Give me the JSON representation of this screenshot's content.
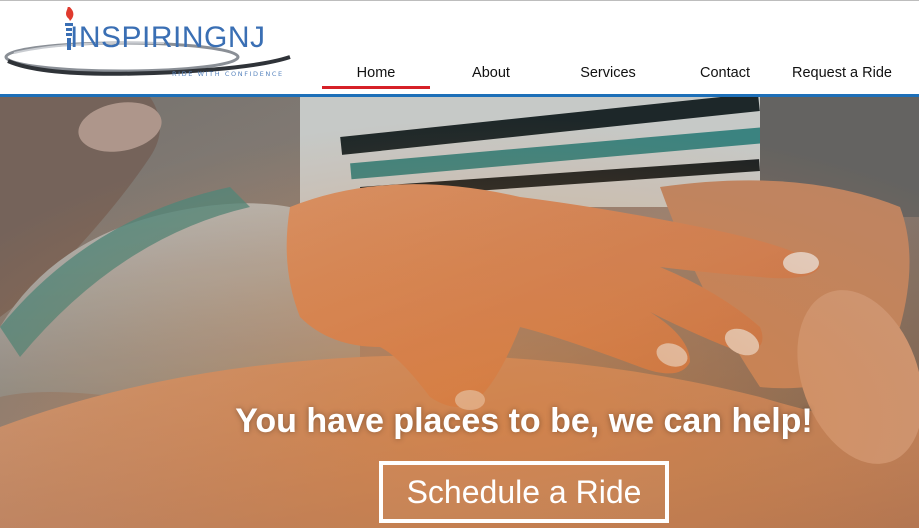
{
  "brand": {
    "name": "INSPIRINGNJ",
    "tagline": "RIDE WITH CONFIDENCE",
    "primary_color": "#3a6fb4",
    "accent_color": "#d62027",
    "logo_icon": "torch-icon"
  },
  "nav": {
    "items": [
      {
        "label": "Home",
        "active": true
      },
      {
        "label": "About",
        "active": false
      },
      {
        "label": "Services",
        "active": false
      },
      {
        "label": "Contact",
        "active": false
      },
      {
        "label": "Request a Ride",
        "active": false
      }
    ],
    "active_indicator_color": "#d62027",
    "rule_color": "#1d6fb8"
  },
  "hero": {
    "image": "hands-holding-photo",
    "headline": "You have places to be, we can help!",
    "cta_label": "Schedule a Ride"
  }
}
